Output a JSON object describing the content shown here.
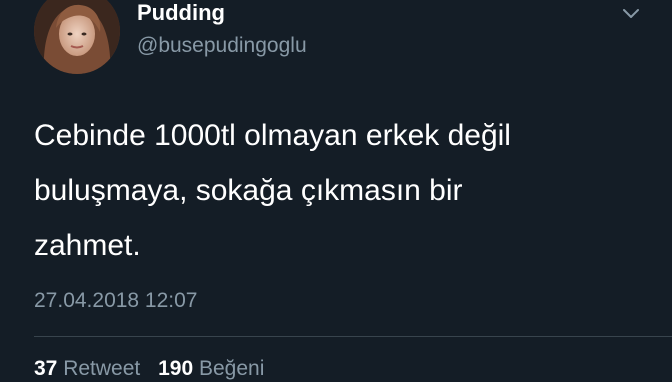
{
  "author": {
    "display_name": "Pudding",
    "handle": "@busepudingoglu",
    "avatar_icon": "profile-photo"
  },
  "tweet": {
    "text": "Cebinde 1000tl olmayan erkek değil\nbuluşmaya, sokağa çıkmasın bir\nzahmet.",
    "timestamp": "27.04.2018 12:07"
  },
  "stats": {
    "retweet_count": "37",
    "retweet_label": "Retweet",
    "like_count": "190",
    "like_label": "Beğeni"
  },
  "colors": {
    "background": "#141d26",
    "primary_text": "#ffffff",
    "secondary_text": "#8899a6",
    "divider": "#38444d"
  }
}
